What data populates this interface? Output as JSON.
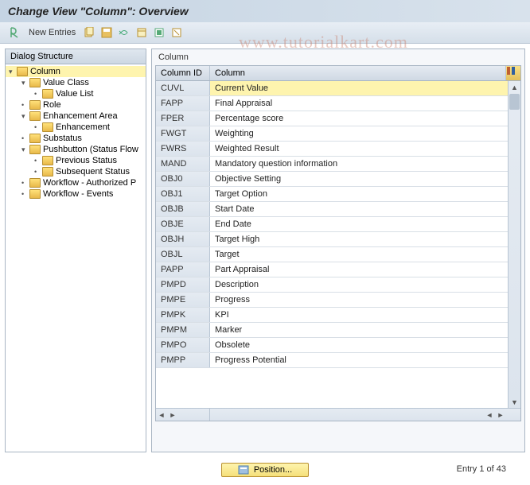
{
  "title": "Change View \"Column\": Overview",
  "watermark": "www.tutorialkart.com",
  "toolbar": {
    "new_entries": "New Entries"
  },
  "tree": {
    "header": "Dialog Structure",
    "items": [
      {
        "label": "Column",
        "level": 0,
        "toggle": "▾",
        "selected": true
      },
      {
        "label": "Value Class",
        "level": 1,
        "toggle": "▾",
        "selected": false
      },
      {
        "label": "Value List",
        "level": 2,
        "toggle": "•",
        "selected": false
      },
      {
        "label": "Role",
        "level": 1,
        "toggle": "•",
        "selected": false
      },
      {
        "label": "Enhancement Area",
        "level": 1,
        "toggle": "▾",
        "selected": false
      },
      {
        "label": "Enhancement",
        "level": 2,
        "toggle": "•",
        "selected": false
      },
      {
        "label": "Substatus",
        "level": 1,
        "toggle": "•",
        "selected": false
      },
      {
        "label": "Pushbutton (Status Flow",
        "level": 1,
        "toggle": "▾",
        "selected": false
      },
      {
        "label": "Previous Status",
        "level": 2,
        "toggle": "•",
        "selected": false
      },
      {
        "label": "Subsequent Status",
        "level": 2,
        "toggle": "•",
        "selected": false
      },
      {
        "label": "Workflow - Authorized P",
        "level": 1,
        "toggle": "•",
        "selected": false
      },
      {
        "label": "Workflow - Events",
        "level": 1,
        "toggle": "•",
        "selected": false
      }
    ]
  },
  "table": {
    "title": "Column",
    "headers": {
      "id": "Column ID",
      "col": "Column"
    },
    "rows": [
      {
        "id": "CUVL",
        "col": "Current Value",
        "sel": true
      },
      {
        "id": "FAPP",
        "col": "Final Appraisal",
        "sel": false
      },
      {
        "id": "FPER",
        "col": "Percentage score",
        "sel": false
      },
      {
        "id": "FWGT",
        "col": "Weighting",
        "sel": false
      },
      {
        "id": "FWRS",
        "col": "Weighted Result",
        "sel": false
      },
      {
        "id": "MAND",
        "col": "Mandatory question information",
        "sel": false
      },
      {
        "id": "OBJ0",
        "col": "Objective Setting",
        "sel": false
      },
      {
        "id": "OBJ1",
        "col": "Target Option",
        "sel": false
      },
      {
        "id": "OBJB",
        "col": "Start Date",
        "sel": false
      },
      {
        "id": "OBJE",
        "col": "End Date",
        "sel": false
      },
      {
        "id": "OBJH",
        "col": "Target High",
        "sel": false
      },
      {
        "id": "OBJL",
        "col": "Target",
        "sel": false
      },
      {
        "id": "PAPP",
        "col": "Part Appraisal",
        "sel": false
      },
      {
        "id": "PMPD",
        "col": "Description",
        "sel": false
      },
      {
        "id": "PMPE",
        "col": "Progress",
        "sel": false
      },
      {
        "id": "PMPK",
        "col": "KPI",
        "sel": false
      },
      {
        "id": "PMPM",
        "col": "Marker",
        "sel": false
      },
      {
        "id": "PMPO",
        "col": "Obsolete",
        "sel": false
      },
      {
        "id": "PMPP",
        "col": "Progress Potential",
        "sel": false
      }
    ]
  },
  "footer": {
    "position_btn": "Position...",
    "entry_text": "Entry 1 of 43"
  }
}
